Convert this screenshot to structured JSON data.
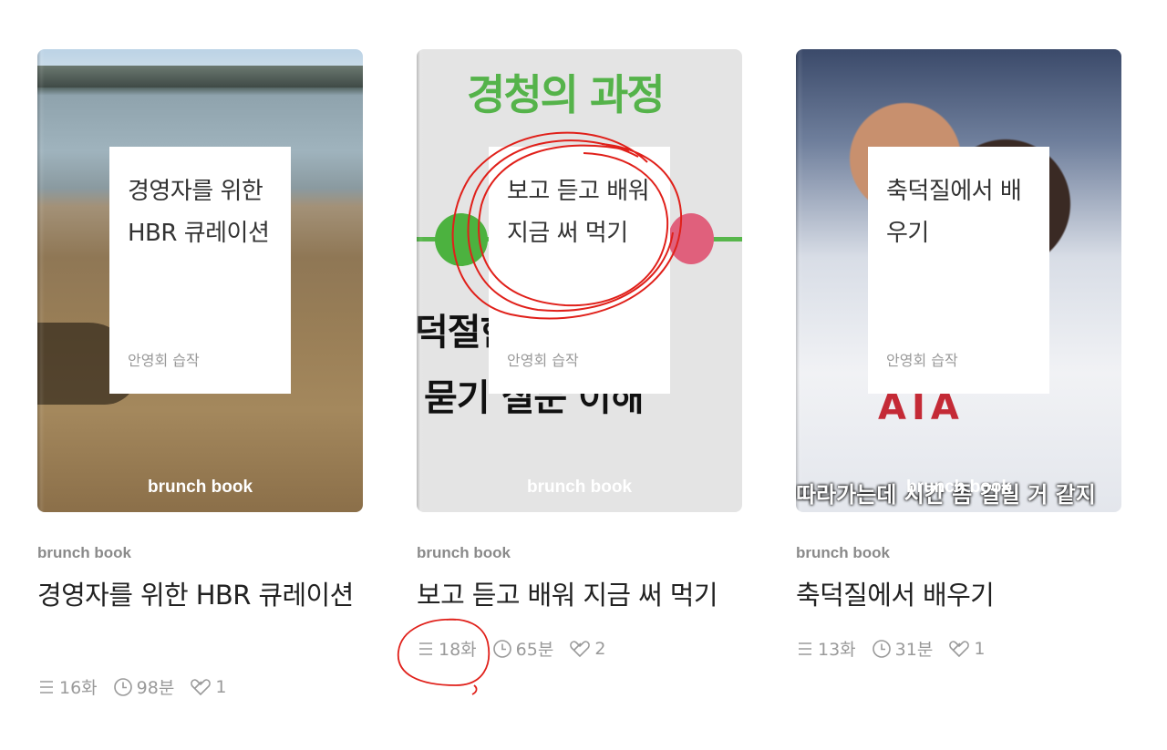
{
  "books": [
    {
      "cover_title": "경영자를 위한 HBR 큐레이션",
      "cover_author": "안영회 습작",
      "cover_brand": "brunch book",
      "kind": "brunch book",
      "title": "경영자를 위한 HBR 큐레이션",
      "episodes": "16화",
      "duration": "98분",
      "likes": "1"
    },
    {
      "cover_title": "보고 듣고 배워 지금 써 먹기",
      "cover_author": "안영회 습작",
      "cover_brand": "brunch book",
      "cover_bg_heading": "경청의 과정",
      "cover_bg_line1": "덕절한 바 야기",
      "cover_bg_line2": "묻기 질문 이해",
      "kind": "brunch book",
      "title": "보고 듣고 배워 지금 써 먹기",
      "episodes": "18화",
      "duration": "65분",
      "likes": "2"
    },
    {
      "cover_title": "축덕질에서 배우기",
      "cover_author": "안영회 습작",
      "cover_brand": "brunch book",
      "cover_bg_caption": "따라가는데 시간 좀 걸릴 거 같지",
      "cover_bg_jersey": "AIA",
      "kind": "brunch book",
      "title": "축덕질에서 배우기",
      "episodes": "13화",
      "duration": "31분",
      "likes": "1"
    }
  ],
  "colors": {
    "annotation": "#e0201a",
    "meta_gray": "#9a9a9a"
  },
  "icons": [
    "list-icon",
    "clock-icon",
    "heart-icon"
  ]
}
